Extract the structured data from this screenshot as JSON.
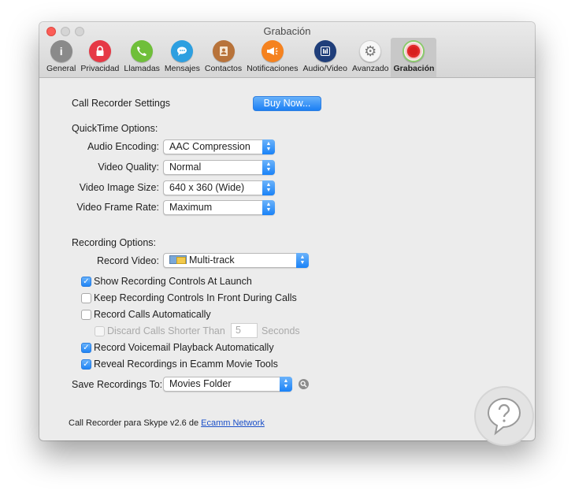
{
  "window": {
    "title": "Grabación"
  },
  "tabs": [
    {
      "label": "General",
      "icon": "info-icon",
      "glyph": "i",
      "color": "#8a8a8a"
    },
    {
      "label": "Privacidad",
      "icon": "lock-icon",
      "glyph": "🔒",
      "color": "#e63946"
    },
    {
      "label": "Llamadas",
      "icon": "phone-icon",
      "glyph": "✆",
      "color": "#6fbf3a"
    },
    {
      "label": "Mensajes",
      "icon": "chat-bubble-icon",
      "glyph": "💬",
      "color": "#2d9fe0"
    },
    {
      "label": "Contactos",
      "icon": "address-book-icon",
      "glyph": "▤",
      "color": "#b8733a"
    },
    {
      "label": "Notificaciones",
      "icon": "megaphone-icon",
      "glyph": "📣",
      "color": "#f5821f"
    },
    {
      "label": "Audio/Video",
      "icon": "equalizer-icon",
      "glyph": "▥",
      "color": "#1f3e7a"
    },
    {
      "label": "Avanzado",
      "icon": "gear-icon",
      "glyph": "⚙",
      "color": "#f2f2f2"
    },
    {
      "label": "Grabación",
      "icon": "record-icon",
      "glyph": "●",
      "color": "#e02a2a",
      "selected": true
    }
  ],
  "settings": {
    "call_recorder_label": "Call Recorder Settings",
    "buy_now_label": "Buy Now...",
    "quicktime_header": "QuickTime Options:",
    "audio_encoding_label": "Audio Encoding:",
    "audio_encoding_value": "AAC Compression",
    "video_quality_label": "Video Quality:",
    "video_quality_value": "Normal",
    "video_image_size_label": "Video Image Size:",
    "video_image_size_value": "640 x 360 (Wide)",
    "video_frame_rate_label": "Video Frame Rate:",
    "video_frame_rate_value": "Maximum",
    "recording_header": "Recording Options:",
    "record_video_label": "Record Video:",
    "record_video_value": "Multi-track",
    "checkboxes": [
      {
        "label": "Show Recording Controls At Launch",
        "checked": true
      },
      {
        "label": "Keep Recording Controls In Front During Calls",
        "checked": false
      },
      {
        "label": "Record Calls Automatically",
        "checked": false
      },
      {
        "label": "Discard Calls Shorter Than",
        "checked": false,
        "disabled": true
      },
      {
        "label": "Record Voicemail Playback Automatically",
        "checked": true
      },
      {
        "label": "Reveal Recordings in Ecamm Movie Tools",
        "checked": true
      }
    ],
    "discard_seconds_value": "5",
    "seconds_label": "Seconds",
    "save_recordings_label": "Save Recordings To:",
    "save_recordings_value": "Movies Folder"
  },
  "footer": {
    "version_text": "Call Recorder para Skype v2.6 de ",
    "link_text": "Ecamm Network"
  },
  "colors": {
    "accent": "#1a82f7",
    "window_bg": "#ececec"
  }
}
